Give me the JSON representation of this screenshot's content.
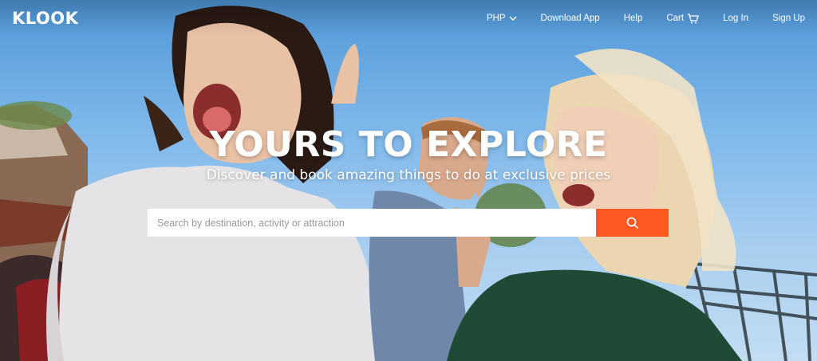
{
  "brand": {
    "logo": "KLOOK"
  },
  "nav": {
    "currency": "PHP",
    "download_app": "Download App",
    "help": "Help",
    "cart": "Cart",
    "log_in": "Log In",
    "sign_up": "Sign Up"
  },
  "hero": {
    "headline": "YOURS TO EXPLORE",
    "subtitle": "Discover and book amazing things to do at exclusive prices"
  },
  "search": {
    "placeholder": "Search by destination, activity or attraction",
    "value": "",
    "button_icon": "search-icon"
  },
  "colors": {
    "accent": "#ff5722",
    "sky": "#7db7ea",
    "text_on_image": "#ffffff"
  },
  "icons": {
    "currency_dropdown": "chevron-down-icon",
    "cart": "cart-icon"
  }
}
